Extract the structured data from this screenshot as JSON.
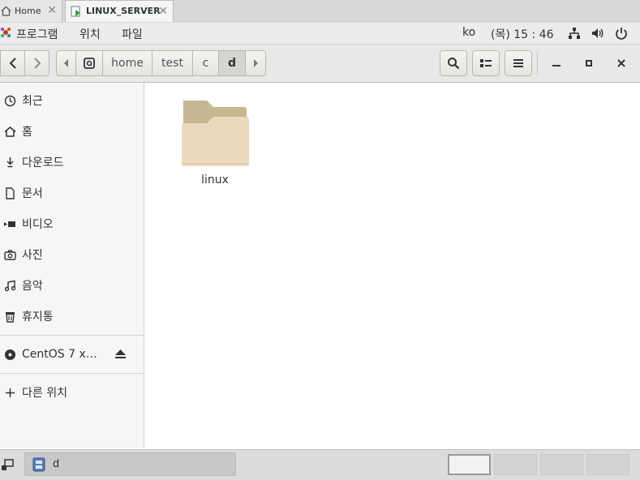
{
  "tabs": [
    {
      "label": "Home"
    },
    {
      "label": "LINUX_SERVER"
    }
  ],
  "topbar": {
    "apps_label": "프로그램",
    "places_label": "위치",
    "files_label": "파일",
    "input_method": "ko",
    "clock": "(목) 15 : 46"
  },
  "path": {
    "segments": [
      "home",
      "test",
      "c",
      "d"
    ],
    "current": "d"
  },
  "sidebar": {
    "items": [
      {
        "label": "최근",
        "icon": "clock-icon"
      },
      {
        "label": "홈",
        "icon": "home-icon"
      },
      {
        "label": "다운로드",
        "icon": "download-icon"
      },
      {
        "label": "문서",
        "icon": "document-icon"
      },
      {
        "label": "비디오",
        "icon": "video-icon"
      },
      {
        "label": "사진",
        "icon": "camera-icon"
      },
      {
        "label": "음악",
        "icon": "music-icon"
      },
      {
        "label": "휴지통",
        "icon": "trash-icon"
      }
    ],
    "device": {
      "label": "CentOS 7 x…",
      "icon": "disc-icon"
    },
    "other": {
      "label": "다른 위치",
      "icon": "plus-icon"
    }
  },
  "content": {
    "items": [
      {
        "name": "linux",
        "type": "folder"
      }
    ]
  },
  "taskbar": {
    "window_label": "d"
  },
  "colors": {
    "folder_back": "#c8b591",
    "folder_front": "#ead9bd",
    "selected_path": "#d4d4d1"
  }
}
